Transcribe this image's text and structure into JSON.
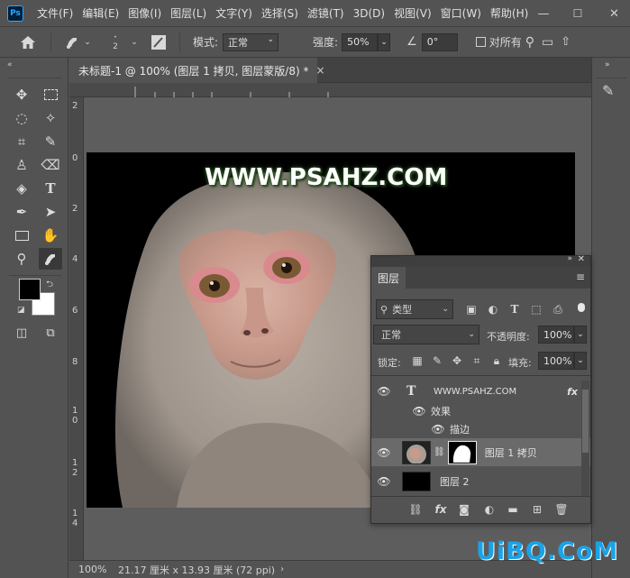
{
  "app": {
    "logo": "Ps"
  },
  "menubar": {
    "items": [
      "文件(F)",
      "编辑(E)",
      "图像(I)",
      "图层(L)",
      "文字(Y)",
      "选择(S)",
      "滤镜(T)",
      "3D(D)",
      "视图(V)",
      "窗口(W)",
      "帮助(H)"
    ]
  },
  "window_controls": {
    "minimize": "—",
    "maximize": "☐",
    "close": "✕"
  },
  "options": {
    "brush_size": "2",
    "mode_label": "模式:",
    "mode_value": "正常",
    "strength_label": "强度:",
    "strength_value": "50%",
    "angle_value": "0°",
    "sample_all_label": "对所有"
  },
  "document": {
    "tab_title": "未标题-1 @ 100% (图层 1 拷贝, 图层蒙版/8) *",
    "close": "×",
    "watermark_text": "WWW.PSAHZ.COM"
  },
  "rulers": {
    "vertical": [
      "2",
      "0",
      "2",
      "4",
      "6",
      "8",
      "1\n0",
      "1\n2",
      "1\n4"
    ]
  },
  "status": {
    "zoom": "100%",
    "doc_size": "21.17 厘米 x 13.93 厘米 (72 ppi)"
  },
  "layers_panel": {
    "title": "图层",
    "filter_kind": "类型",
    "blend_mode": "正常",
    "opacity_label": "不透明度:",
    "opacity_value": "100%",
    "lock_label": "锁定:",
    "fill_label": "填充:",
    "fill_value": "100%",
    "layers": [
      {
        "name": "WWW.PSAHZ.COM",
        "type": "text",
        "fx": "fx"
      },
      {
        "name": "效果",
        "type": "effects"
      },
      {
        "name": "描边",
        "type": "effect-item"
      },
      {
        "name": "图层 1 拷贝",
        "type": "image-with-mask",
        "selected": true
      },
      {
        "name": "图层 2",
        "type": "fill-black"
      }
    ]
  },
  "site_logo": "UiBQ.CoM",
  "colors": {
    "ui_bg": "#535353",
    "canvas_bg": "#000000",
    "foreground_swatch": "#000000",
    "background_swatch": "#ffffff",
    "logo_blue": "#1aa3e8"
  }
}
